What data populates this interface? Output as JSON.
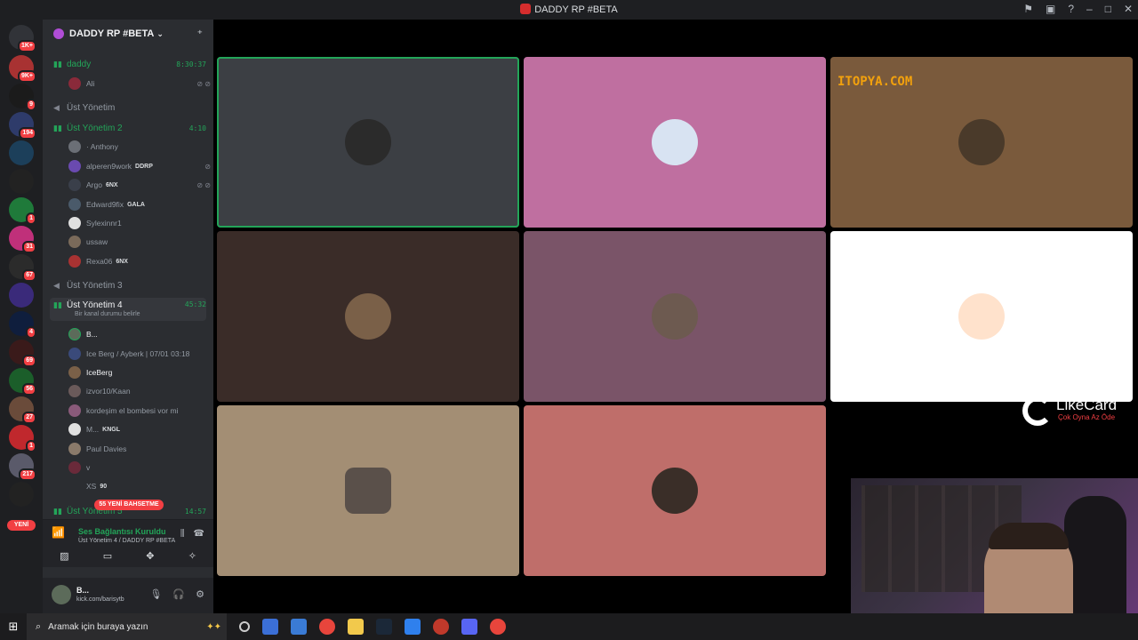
{
  "window": {
    "title": "DADDY RP #BETA"
  },
  "servers": {
    "badges": [
      "1K+",
      "9K+",
      "9",
      "194",
      "",
      "",
      "1",
      "31",
      "67",
      "",
      "4",
      "69",
      "56",
      "27",
      "1",
      "217",
      ""
    ],
    "new_label": "YENİ"
  },
  "guild": {
    "name": "DADDY RP #BETA"
  },
  "channels": [
    {
      "name": "daddy",
      "timer": "8:30:37",
      "live": true
    },
    {
      "name": "Üst Yönetim",
      "timer": "",
      "live": false
    },
    {
      "name": "Üst Yönetim 2",
      "timer": "4:10",
      "live": true
    },
    {
      "name": "Üst Yönetim 3",
      "timer": "",
      "live": false
    },
    {
      "name": "Üst Yönetim 4",
      "timer": "45:32",
      "live": true,
      "status": "Bir kanal durumu belirle"
    },
    {
      "name": "Üst Yönetim 5",
      "timer": "14:57",
      "live": true
    }
  ],
  "users": {
    "daddy": [
      {
        "name": "Ali"
      }
    ],
    "ust2": [
      {
        "name": "· Anthony",
        "tag": ""
      },
      {
        "name": "alperen9work",
        "tag": "DDRP"
      },
      {
        "name": "Argo",
        "tag": "6NX"
      },
      {
        "name": "Edward9fix",
        "tag": "GALA"
      },
      {
        "name": "Sylexinnr1",
        "tag": ""
      },
      {
        "name": "ussaw",
        "tag": ""
      },
      {
        "name": "Rexa06",
        "tag": "6NX"
      }
    ],
    "ust4": [
      {
        "name": "B...",
        "tag": ""
      },
      {
        "name": "Ice Berg / Ayberk | 07/01 03:18",
        "tag": ""
      },
      {
        "name": "IceBerg",
        "tag": ""
      },
      {
        "name": "izvor10/Kaan",
        "tag": ""
      },
      {
        "name": "kordeşim el bombesi vor mi",
        "tag": ""
      },
      {
        "name": "M...",
        "tag": "KNGL"
      },
      {
        "name": "Paul Davies",
        "tag": ""
      },
      {
        "name": "v",
        "tag": ""
      },
      {
        "name": "XS",
        "tag": "90"
      }
    ]
  },
  "mention_pill": "55 YENİ BAHSETME",
  "voice_status": {
    "title": "Ses Bağlantısı Kuruldu",
    "subtitle": "Üst Yönetim 4 / DADDY RP #BETA"
  },
  "user_panel": {
    "name": "B...",
    "status": "kick.com/barisytb"
  },
  "tiles": [
    {
      "bg": "#3c3f44",
      "avatar": "#2b2b2b",
      "speaking": true
    },
    {
      "bg": "#bf6fa0",
      "avatar": "#d8e3f2",
      "speaking": false
    },
    {
      "bg": "#7a5a3c",
      "avatar": "#4a3a2a",
      "speaking": false
    },
    {
      "bg": "#3a2c28",
      "avatar": "#7a6048",
      "speaking": false
    },
    {
      "bg": "#7a5468",
      "avatar": "#6d5a50",
      "speaking": false
    },
    {
      "bg": "#ffffff",
      "avatar": "#ffe2cc",
      "speaking": false
    },
    {
      "bg": "#a38e74",
      "avatar": "#5a504a",
      "speaking": false
    },
    {
      "bg": "#bf6e6a",
      "avatar": "#3a2e28",
      "speaking": false
    }
  ],
  "overlays": {
    "watermark": "ITOPYA.COM",
    "likecard_title": "LikeCard",
    "likecard_slogan": "Çok Oyna  Az Öde"
  },
  "taskbar": {
    "search_placeholder": "Aramak için buraya yazın"
  },
  "colors": {
    "accent_green": "#23a559",
    "danger_red": "#f23f43",
    "sidebar_bg": "#2b2d31",
    "rail_bg": "#1e1f22"
  }
}
